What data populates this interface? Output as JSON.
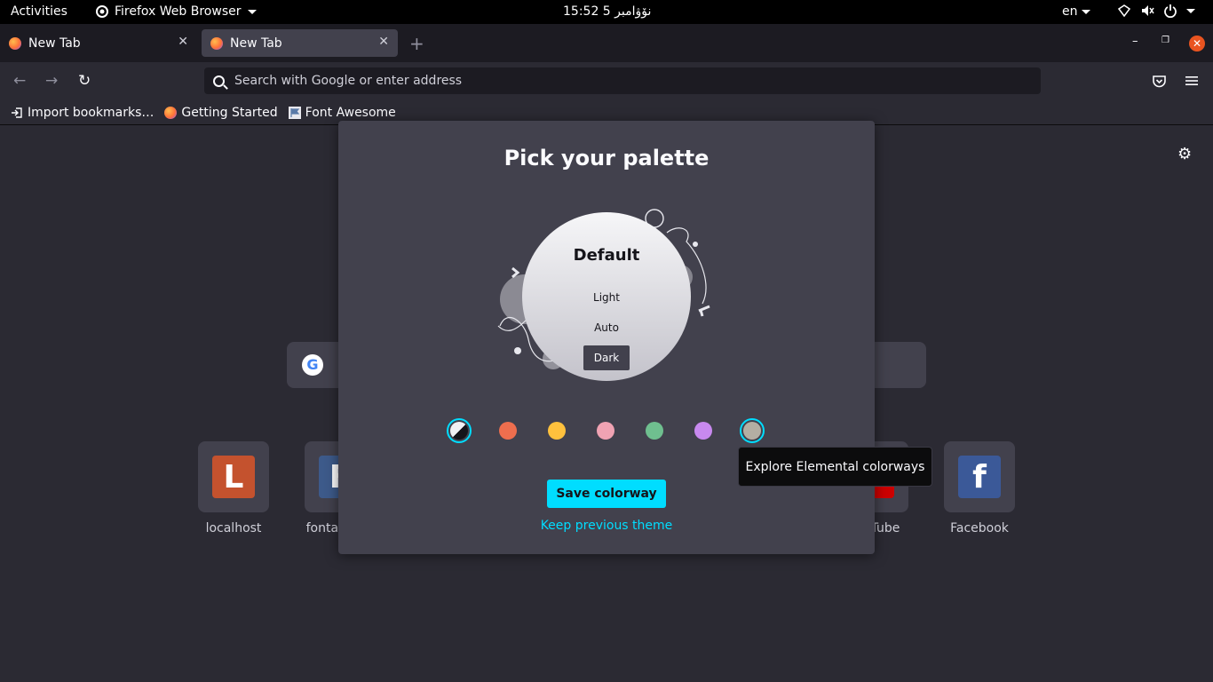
{
  "topbar": {
    "activities": "Activities",
    "app_name": "Firefox Web Browser",
    "clock": "15:52  5 نۆۋامبر",
    "lang": "en"
  },
  "tabs": [
    {
      "label": "New Tab",
      "active": false
    },
    {
      "label": "New Tab",
      "active": true
    }
  ],
  "urlbar": {
    "placeholder": "Search with Google or enter address"
  },
  "bookmarks": [
    {
      "label": "Import bookmarks…"
    },
    {
      "label": "Getting Started"
    },
    {
      "label": "Font Awesome"
    }
  ],
  "top_sites": [
    {
      "label": "localhost",
      "letter": "L",
      "color": "#c4522e"
    },
    {
      "label": "fontav",
      "letter": "F",
      "color": "#3d5a8a"
    },
    {
      "label": "Tube",
      "letter": "▶",
      "color": "#cc0000"
    },
    {
      "label": "Facebook",
      "letter": "f",
      "color": "#3b5998"
    }
  ],
  "dialog": {
    "title": "Pick your palette",
    "colorway_name": "Default",
    "variations": [
      "Light",
      "Auto",
      "Dark"
    ],
    "selected_variation": "Dark",
    "swatches": [
      {
        "name": "default",
        "color": "#15141a",
        "selected": true
      },
      {
        "name": "playmaker",
        "color": "#ee6e4e",
        "selected": false
      },
      {
        "name": "expressionist",
        "color": "#ffc13d",
        "selected": false
      },
      {
        "name": "visionary",
        "color": "#f0a3b3",
        "selected": false
      },
      {
        "name": "activist",
        "color": "#6fbf8f",
        "selected": false
      },
      {
        "name": "dreamer",
        "color": "#c889ef",
        "selected": false
      },
      {
        "name": "elemental",
        "color": "#b4aea3",
        "selected": false,
        "hover": true
      }
    ],
    "save_label": "Save colorway",
    "keep_label": "Keep previous theme"
  },
  "tooltip": "Explore Elemental colorways"
}
